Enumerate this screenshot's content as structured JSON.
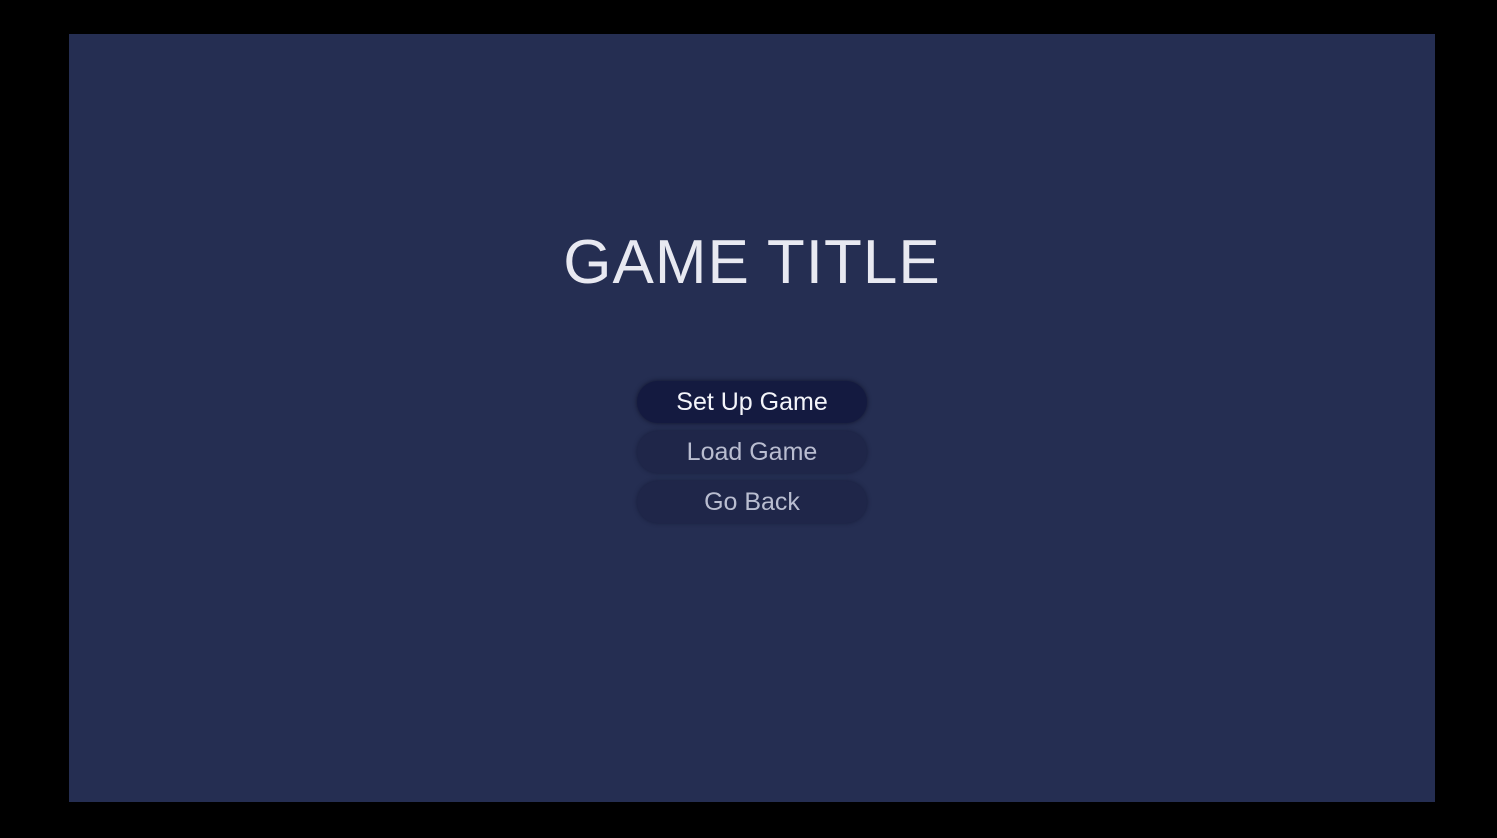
{
  "screen": {
    "title": "GAME TITLE",
    "background_color": "#252e52"
  },
  "menu": {
    "items": [
      {
        "label": "Set Up Game",
        "selected": true
      },
      {
        "label": "Load Game",
        "selected": false
      },
      {
        "label": "Go Back",
        "selected": false
      }
    ]
  }
}
